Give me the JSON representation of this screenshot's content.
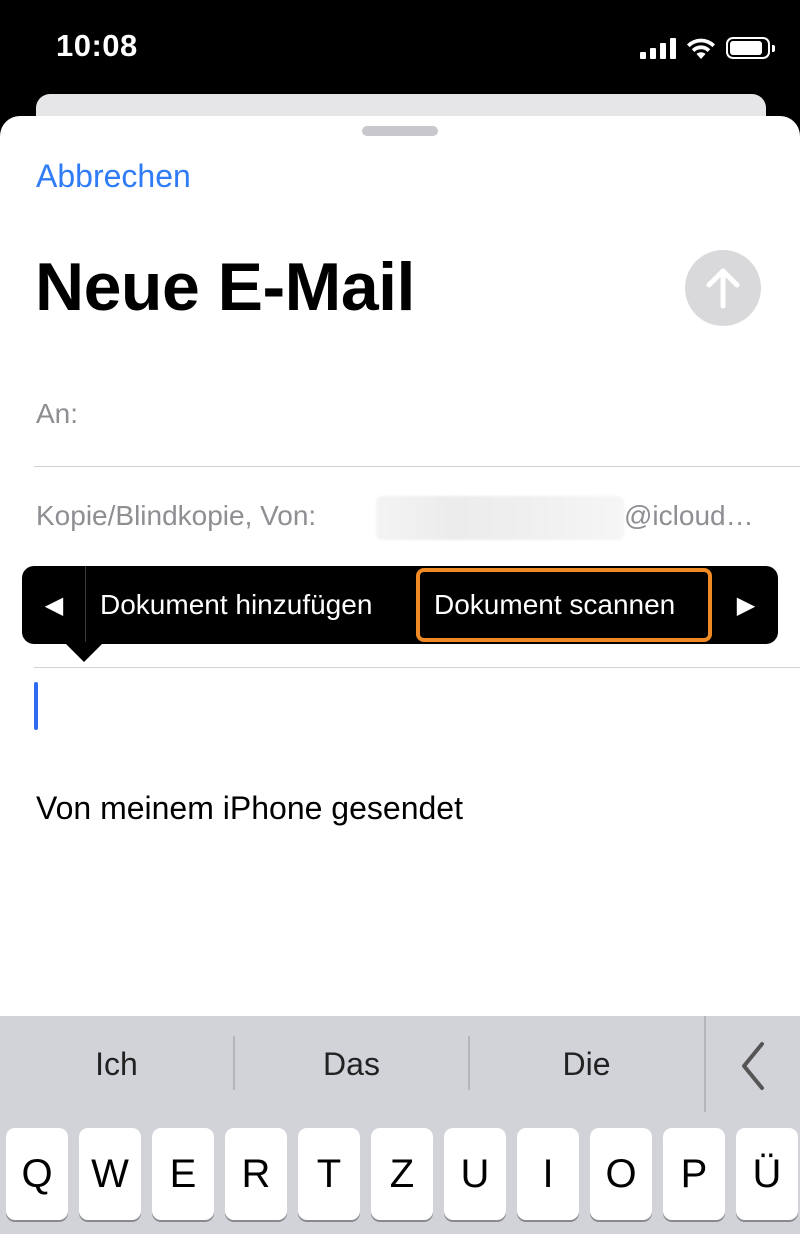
{
  "status_bar": {
    "time": "10:08",
    "icons": [
      "cellular-signal-icon",
      "wifi-icon",
      "battery-icon"
    ],
    "battery_level": 0.9
  },
  "compose": {
    "cancel_label": "Abbrechen",
    "title": "Neue E-Mail",
    "send_icon": "arrow-up-icon",
    "to_label": "An:",
    "cc_label": "Kopie/Blindkopie, Von:",
    "from_domain": "@icloud…",
    "signature": "Von meinem iPhone gesendet"
  },
  "edit_menu": {
    "prev_glyph": "◀",
    "items": [
      "Dokument hinzufügen",
      "Dokument scannen"
    ],
    "next_glyph": "▶",
    "highlight_color": "#f08a24"
  },
  "keyboard": {
    "suggestions": [
      "Ich",
      "Das",
      "Die"
    ],
    "collapse_icon": "chevron-left-icon",
    "row1": [
      "Q",
      "W",
      "E",
      "R",
      "T",
      "Z",
      "U",
      "I",
      "O",
      "P",
      "Ü"
    ]
  },
  "colors": {
    "accent": "#2f7cf6",
    "send_disabled": "#d9d9dc",
    "cursor": "#2f6bf0"
  }
}
